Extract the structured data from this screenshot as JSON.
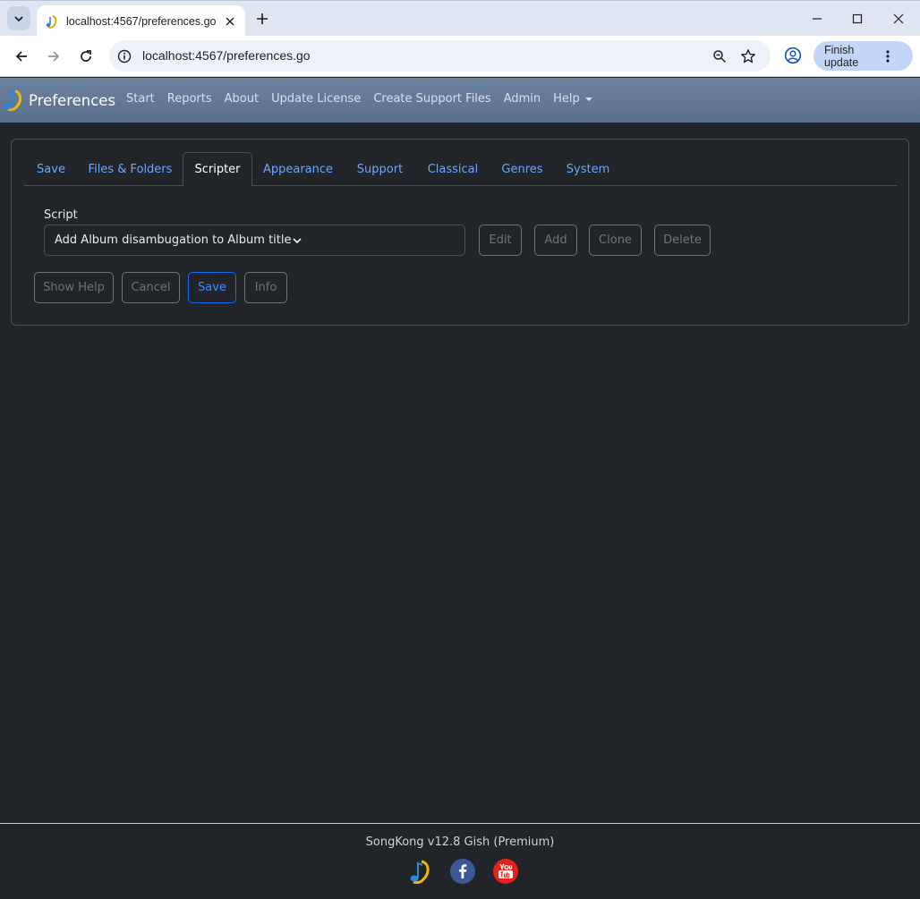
{
  "browser": {
    "tab_title": "localhost:4567/preferences.go",
    "url": "localhost:4567/preferences.go",
    "finish_update_label": "Finish update",
    "icons": [
      "tab-list-icon",
      "favicon",
      "close-tab-icon",
      "new-tab-icon",
      "minimize-icon",
      "maximize-icon",
      "close-window-icon",
      "back-icon",
      "forward-icon",
      "reload-icon",
      "site-info-icon",
      "zoom-icon",
      "bookmark-star-icon",
      "profile-icon",
      "more-vert-icon"
    ]
  },
  "navbar": {
    "brand": "Preferences",
    "links": {
      "start": "Start",
      "reports": "Reports",
      "about": "About",
      "update_license": "Update License",
      "create_support_files": "Create Support Files",
      "admin": "Admin",
      "help": "Help"
    }
  },
  "tabs": {
    "save": "Save",
    "files_folders": "Files & Folders",
    "scripter": "Scripter",
    "appearance": "Appearance",
    "support": "Support",
    "classical": "Classical",
    "genres": "Genres",
    "system": "System",
    "active": "Scripter"
  },
  "scripter": {
    "script_label": "Script",
    "selected_script": "Add Album disambugation to Album title",
    "edit": "Edit",
    "add": "Add",
    "clone": "Clone",
    "delete": "Delete"
  },
  "actions": {
    "show_help": "Show Help",
    "cancel": "Cancel",
    "save": "Save",
    "info": "Info"
  },
  "footer": {
    "version": "SongKong v12.8 Gish (Premium)"
  },
  "colors": {
    "page_bg": "#212529",
    "navbar_bg": "#62789a",
    "link_blue": "#6ea8fe",
    "primary": "#0d6efd",
    "facebook": "#3b5998",
    "youtube": "#e62117"
  }
}
